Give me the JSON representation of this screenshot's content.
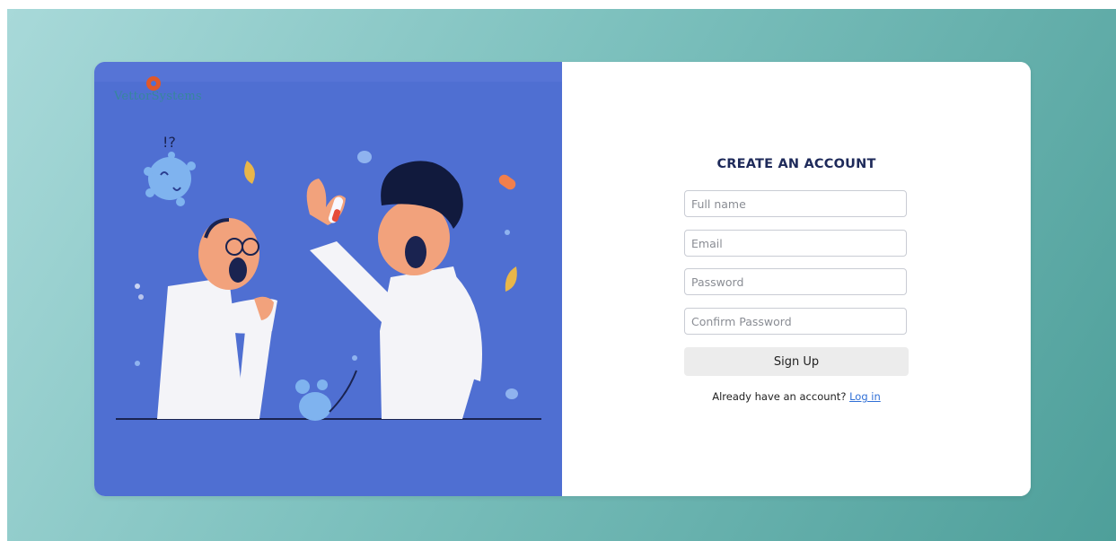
{
  "brand": {
    "logo_text": "VettorSystems"
  },
  "form": {
    "title": "CREATE AN ACCOUNT",
    "full_name_placeholder": "Full name",
    "email_placeholder": "Email",
    "password_placeholder": "Password",
    "confirm_password_placeholder": "Confirm Password",
    "submit_label": "Sign Up",
    "login_prompt": "Already have an account?",
    "login_link": "Log in"
  },
  "illustration": {
    "exclaim_text": "!?"
  },
  "colors": {
    "illustration_bg": "#4f6fd2",
    "title": "#1e2a5a",
    "link": "#2f6fd6",
    "button_bg": "#ececec"
  }
}
